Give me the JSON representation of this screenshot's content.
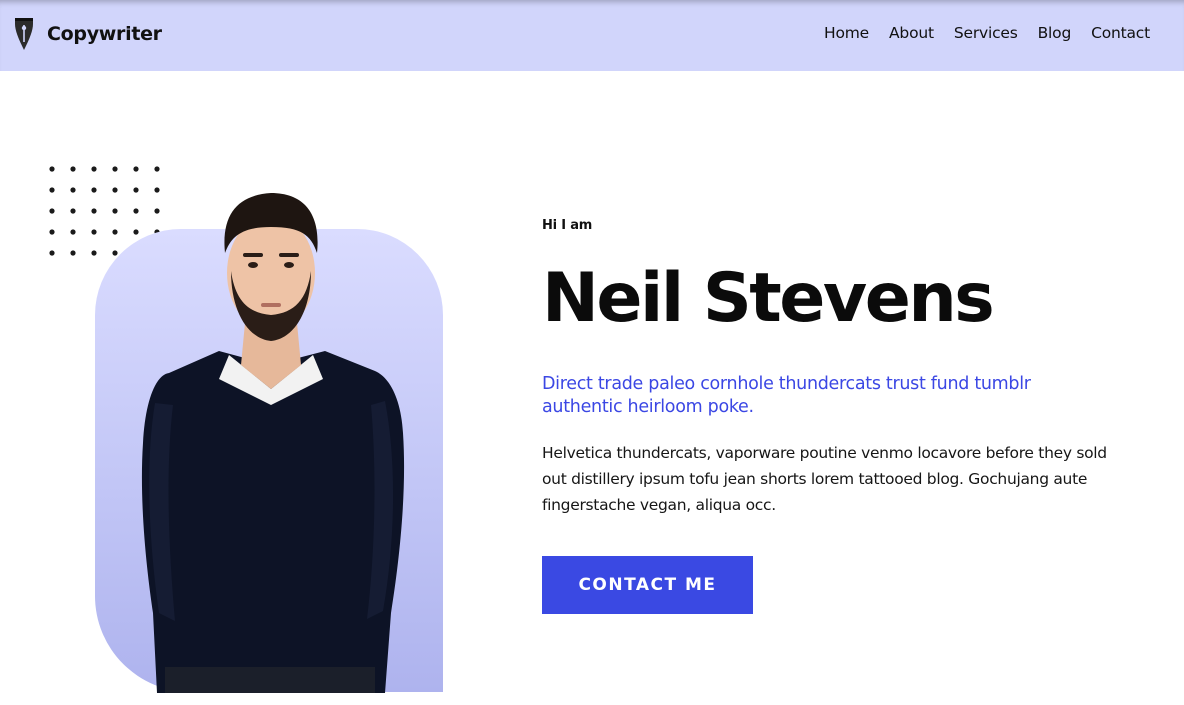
{
  "header": {
    "brand_name": "Copywriter",
    "brand_icon": "fountain-pen-nib-icon",
    "nav": {
      "home": "Home",
      "about": "About",
      "services": "Services",
      "blog": "Blog",
      "contact": "Contact"
    }
  },
  "hero": {
    "eyebrow": "Hi I am",
    "name": "Neil Stevens",
    "tagline": "Direct trade paleo cornhole thundercats trust fund tumblr authentic heirloom poke.",
    "bio": "Helvetica thundercats, vaporware poutine venmo locavore before they sold out distillery ipsum tofu jean shorts lorem tattooed blog. Gochujang aute fingerstache vegan, aliqua occ.",
    "cta_label": "CONTACT ME"
  },
  "colors": {
    "header_bg": "#d1d5fb",
    "accent": "#3a49e3",
    "tagline": "#3b47e4"
  }
}
